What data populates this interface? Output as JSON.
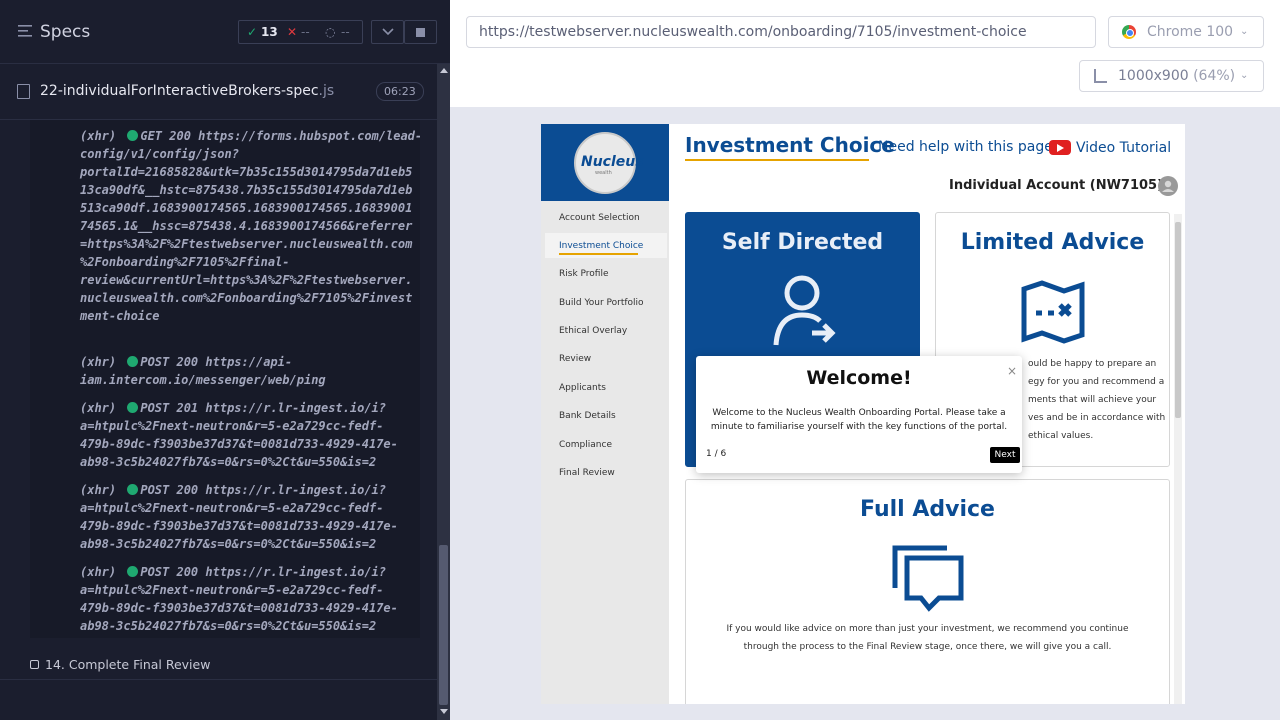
{
  "runner": {
    "title": "Specs",
    "passed_count": "13",
    "failed_count": "--",
    "pending_count": "--",
    "spec_file_name": "22-individualForInteractiveBrokers-spec",
    "spec_file_ext": ".js",
    "duration": "06:23",
    "log_entries": [
      {
        "prefix": "(xhr)",
        "method": "GET 200",
        "text": "https://forms.hubspot.com/lead-flows-\nconfig/v1/config/json?\nportalId=21685828&utk=7b35c155d3014795da7d1eb5\n13ca90df&__hstc=875438.7b35c155d3014795da7d1eb\n513ca90df.1683900174565.1683900174565.16839001\n74565.1&__hssc=875438.4.1683900174566&referrer\n=https%3A%2F%2Ftestwebserver.nucleuswealth.com\n%2Fonboarding%2F7105%2Ffinal-\nreview&currentUrl=https%3A%2F%2Ftestwebserver.\nnucleuswealth.com%2Fonboarding%2F7105%2Finvest\nment-choice"
      },
      {
        "prefix": "(xhr)",
        "method": "POST 200",
        "text": "https://api-\niam.intercom.io/messenger/web/ping"
      },
      {
        "prefix": "(xhr)",
        "method": "POST 201",
        "text": "https://r.lr-ingest.io/i?\na=htpulc%2Fnext-neutron&r=5-e2a729cc-fedf-\n479b-89dc-f3903be37d37&t=0081d733-4929-417e-\nab98-3c5b24027fb7&s=0&rs=0%2Ct&u=550&is=2"
      },
      {
        "prefix": "(xhr)",
        "method": "POST 200",
        "text": "https://r.lr-ingest.io/i?\na=htpulc%2Fnext-neutron&r=5-e2a729cc-fedf-\n479b-89dc-f3903be37d37&t=0081d733-4929-417e-\nab98-3c5b24027fb7&s=0&rs=0%2Ct&u=550&is=2"
      },
      {
        "prefix": "(xhr)",
        "method": "POST 200",
        "text": "https://r.lr-ingest.io/i?\na=htpulc%2Fnext-neutron&r=5-e2a729cc-fedf-\n479b-89dc-f3903be37d37&t=0081d733-4929-417e-\nab98-3c5b24027fb7&s=0&rs=0%2Ct&u=550&is=2"
      }
    ],
    "step_label": "14. Complete Final Review"
  },
  "browser_bar": {
    "url": "https://testwebserver.nucleuswealth.com/onboarding/7105/investment-choice",
    "browser": "Chrome 100",
    "viewport": "1000x900",
    "scale": "(64%)"
  },
  "app": {
    "logo_text": "Nucleus",
    "logo_sub": "wealth",
    "nav_items": [
      "Account Selection",
      "Investment Choice",
      "Risk Profile",
      "Build Your Portfolio",
      "Ethical Overlay",
      "Review",
      "Applicants",
      "Bank Details",
      "Compliance",
      "Final Review"
    ],
    "active_nav": "Investment Choice",
    "page_title": "Investment Choice",
    "help_text": "Need help with this page?",
    "video_link": "Video Tutorial",
    "account_label": "Individual Account (NW7105)",
    "cards": {
      "self_directed": "Self Directed",
      "limited_advice": "Limited Advice",
      "limited_advice_text": [
        "ould be happy to prepare an",
        "egy for you and recommend a",
        "ments that will achieve your",
        "ves and be in accordance with",
        "ethical values."
      ],
      "full_advice": "Full Advice",
      "full_advice_text": [
        "If you would like advice on more than just your investment, we recommend you continue",
        "through the process to the Final Review stage, once there, we will give you a call."
      ]
    },
    "modal": {
      "title": "Welcome!",
      "close": "×",
      "body": "Welcome to the Nucleus Wealth Onboarding Portal. Please take a minute to familiarise yourself with the key functions of the portal.",
      "step": "1 / 6",
      "next": "Next"
    }
  },
  "colors": {
    "brand_blue": "#0b4c93",
    "accent": "#e6a300",
    "pass": "#1fa971",
    "fail": "#e0393e"
  }
}
